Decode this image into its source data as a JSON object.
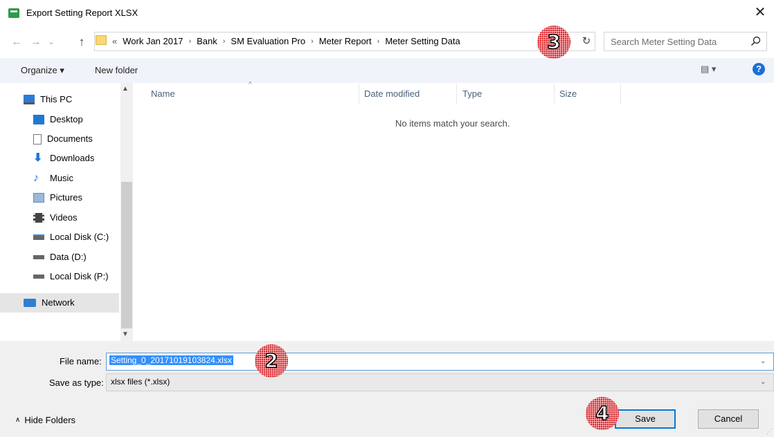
{
  "window": {
    "title": "Export Setting Report XLSX",
    "close_label": "✕"
  },
  "nav": {
    "back": "←",
    "forward": "→",
    "recent": "⌄",
    "up": "↑"
  },
  "address": {
    "overflow": "«",
    "crumbs": [
      "Work Jan 2017",
      "Bank",
      "SM Evaluation Pro",
      "Meter Report",
      "Meter Setting Data"
    ],
    "separator": "›"
  },
  "search": {
    "placeholder": "Search Meter Setting Data"
  },
  "toolbar": {
    "organize": "Organize ▾",
    "new_folder": "New folder",
    "view": "▤ ▾",
    "help": "?"
  },
  "sidebar": {
    "items": [
      {
        "label": "This PC",
        "icon": "monitor-icon"
      },
      {
        "label": "Desktop",
        "icon": "desktop-icon"
      },
      {
        "label": "Documents",
        "icon": "documents-icon"
      },
      {
        "label": "Downloads",
        "icon": "downloads-icon"
      },
      {
        "label": "Music",
        "icon": "music-icon"
      },
      {
        "label": "Pictures",
        "icon": "pictures-icon"
      },
      {
        "label": "Videos",
        "icon": "videos-icon"
      },
      {
        "label": "Local Disk (C:)",
        "icon": "drive-icon"
      },
      {
        "label": "Data (D:)",
        "icon": "drive-icon"
      },
      {
        "label": "Local Disk (P:)",
        "icon": "drive-icon"
      },
      {
        "label": "Network",
        "icon": "network-icon"
      }
    ]
  },
  "filelist": {
    "columns": [
      "Name",
      "Date modified",
      "Type",
      "Size"
    ],
    "empty_message": "No items match your search."
  },
  "form": {
    "file_name_label": "File name:",
    "file_name_value": "Setting_0_20171019103824.xlsx",
    "save_type_label": "Save as type:",
    "save_type_value": "xlsx files (*.xlsx)"
  },
  "footer": {
    "hide_folders": "Hide Folders",
    "save": "Save",
    "cancel": "Cancel"
  },
  "markers": [
    "3",
    "2",
    "4"
  ],
  "colors": {
    "accent": "#0078d7",
    "selection": "#3390ff",
    "marker": "#d8282f",
    "toolbar_bg": "#f0f4fa"
  }
}
